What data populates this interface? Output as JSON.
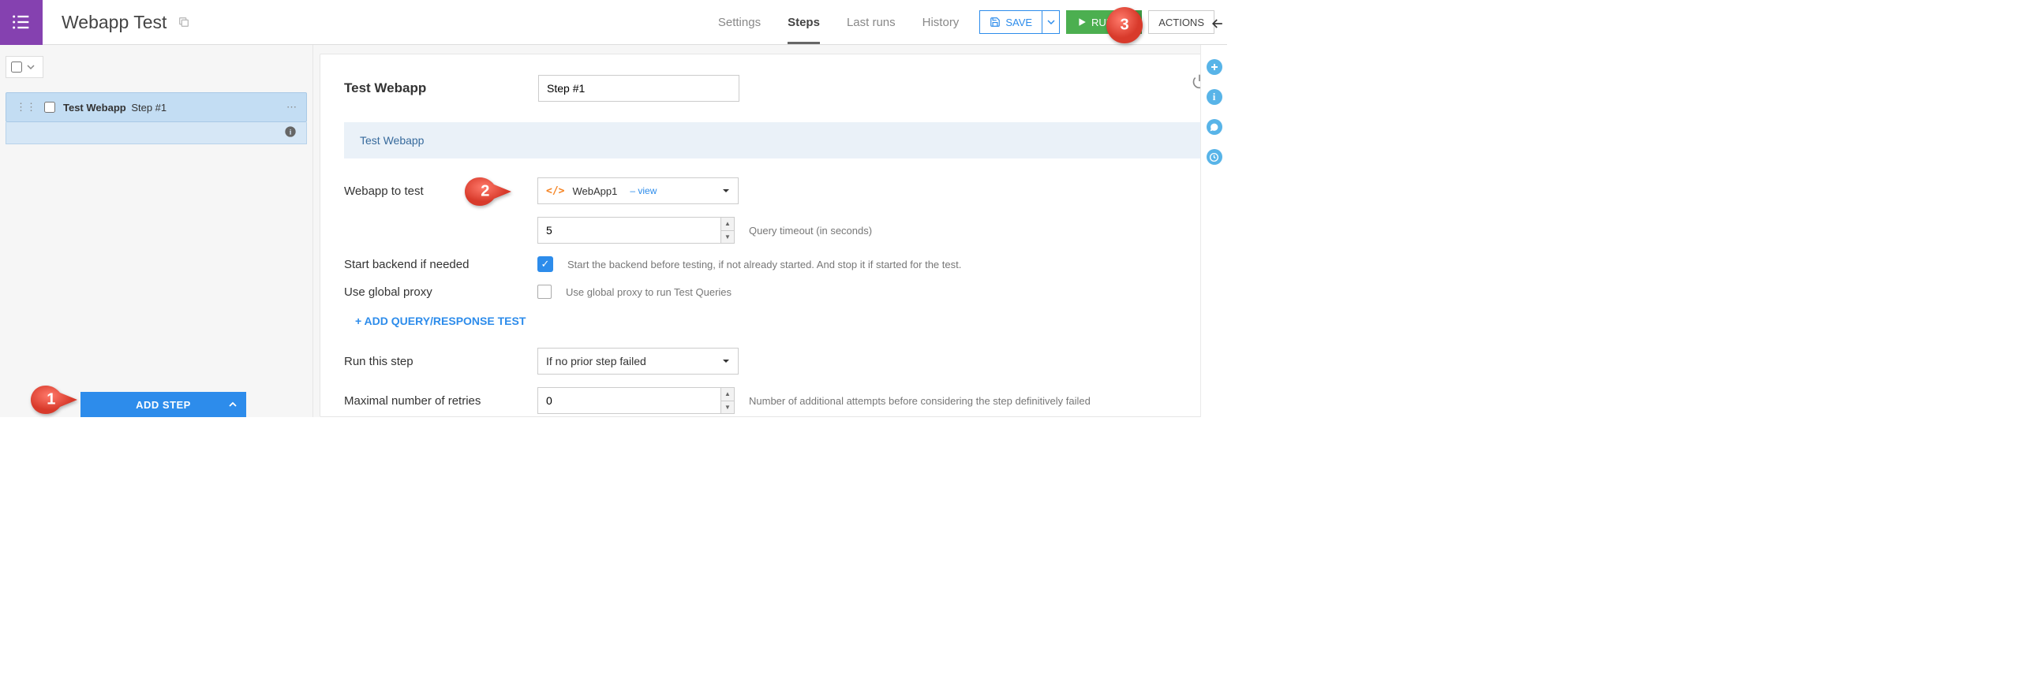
{
  "header": {
    "page_title": "Webapp Test",
    "tabs": [
      "Settings",
      "Steps",
      "Last runs",
      "History"
    ],
    "active_tab": "Steps",
    "save_label": "SAVE",
    "run_label": "RUN",
    "actions_label": "ACTIONS"
  },
  "left": {
    "step": {
      "type": "Test Webapp",
      "name": "Step #1"
    },
    "add_step_label": "ADD STEP"
  },
  "main": {
    "title": "Test Webapp",
    "step_name_value": "Step #1",
    "banner": "Test Webapp",
    "labels": {
      "webapp_to_test": "Webapp to test",
      "start_backend": "Start backend if needed",
      "use_global_proxy": "Use global proxy",
      "run_this_step": "Run this step",
      "max_retries": "Maximal number of retries"
    },
    "webapp_select": {
      "name": "WebApp1",
      "view_link_prefix": "– ",
      "view_link": "view"
    },
    "timeout_value": "5",
    "timeout_help": "Query timeout (in seconds)",
    "start_backend_checked": true,
    "start_backend_help": "Start the backend before testing, if not already started. And stop it if started for the test.",
    "use_proxy_checked": false,
    "use_proxy_help": "Use global proxy to run Test Queries",
    "add_qr_label": "+ ADD QUERY/RESPONSE TEST",
    "run_step_value": "If no prior step failed",
    "retries_value": "0",
    "retries_help": "Number of additional attempts before considering the step definitively failed"
  },
  "callouts": {
    "c1": "1",
    "c2": "2",
    "c3": "3"
  }
}
